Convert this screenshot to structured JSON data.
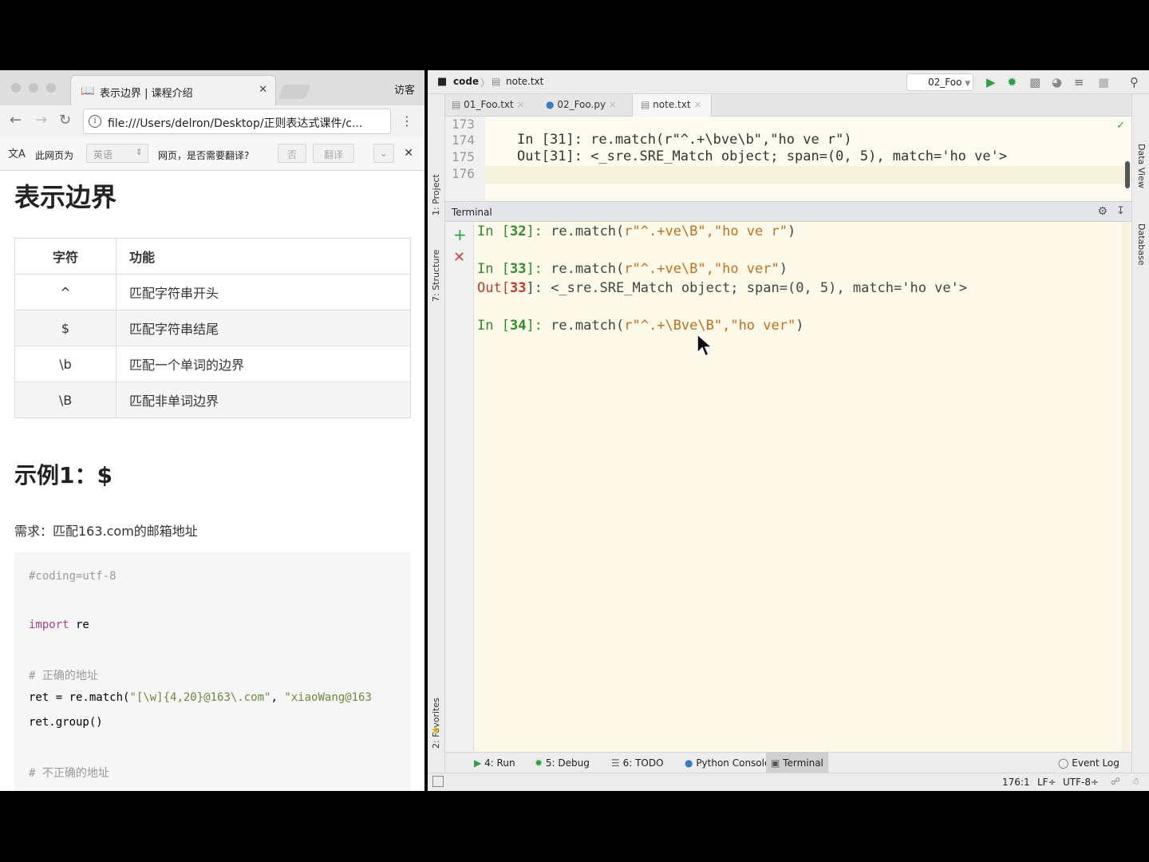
{
  "browser": {
    "tab_title": "表示边界 | 课程介绍",
    "guest_label": "访客",
    "url": "file:///Users/delron/Desktop/正则表达式课件/c...",
    "translate": {
      "prefix": "此网页为",
      "language": "英语",
      "question": "网页，是否需要翻译?",
      "no_button": "否",
      "translate_button": "翻译"
    },
    "page": {
      "heading": "表示边界",
      "table": {
        "headers": [
          "字符",
          "功能"
        ],
        "rows": [
          [
            "^",
            "匹配字符串开头"
          ],
          [
            "$",
            "匹配字符串结尾"
          ],
          [
            "\\b",
            "匹配一个单词的边界"
          ],
          [
            "\\B",
            "匹配非单词边界"
          ]
        ]
      },
      "example_heading": "示例1：$",
      "requirement": "需求：匹配163.com的邮箱地址",
      "code": {
        "line1": "#coding=utf-8",
        "line2_kw": "import",
        "line2_rest": " re",
        "line3": "# 正确的地址",
        "line4_a": "ret = re.match(",
        "line4_b": "\"[\\w]{4,20}@163\\.com\"",
        "line4_c": ", ",
        "line4_d": "\"xiaoWang@163",
        "line5": "ret.group()",
        "line6": "# 不正确的地址"
      }
    }
  },
  "ide": {
    "breadcrumb": [
      "code",
      "note.txt"
    ],
    "run_config": "02_Foo",
    "file_tabs": [
      "01_Foo.txt",
      "02_Foo.py",
      "note.txt"
    ],
    "left_tools": [
      "1: Project",
      "7: Structure",
      "2: Favorites"
    ],
    "right_tools": [
      "Data View",
      "Database"
    ],
    "editor_lines": [
      {
        "num": "173",
        "text": ""
      },
      {
        "num": "174",
        "text": "In [31]: re.match(r\"^.+\\bve\\b\",\"ho ve r\")"
      },
      {
        "num": "175",
        "text": "Out[31]: <_sre.SRE_Match object; span=(0, 5), match='ho ve'>"
      },
      {
        "num": "176",
        "text": ""
      }
    ],
    "terminal_title": "Terminal",
    "terminal": {
      "in32_label": "In [",
      "in32_num": "32",
      "in32_close": "]: ",
      "in32_code_a": "re.match(",
      "in32_code_b": "r\"^.+ve\\B\",\"ho ve r\"",
      "in32_code_c": ")",
      "in33_num": "33",
      "in33_code_b": "r\"^.+ve\\B\",\"ho ver\"",
      "out33_label": "Out[",
      "out33_num": "33",
      "out33_rest": "]: <_sre.SRE_Match object; span=(0, 5), match='ho ve'>",
      "in34_num": "34",
      "in34_code_b": "r\"^.+\\Bve\\B\",\"ho ver\""
    },
    "bottom_tabs": [
      "4: Run",
      "5: Debug",
      "6: TODO",
      "Python Console",
      "Terminal"
    ],
    "event_log": "Event Log",
    "status": {
      "position": "176:1",
      "line_sep": "LF÷",
      "encoding": "UTF-8÷"
    }
  }
}
